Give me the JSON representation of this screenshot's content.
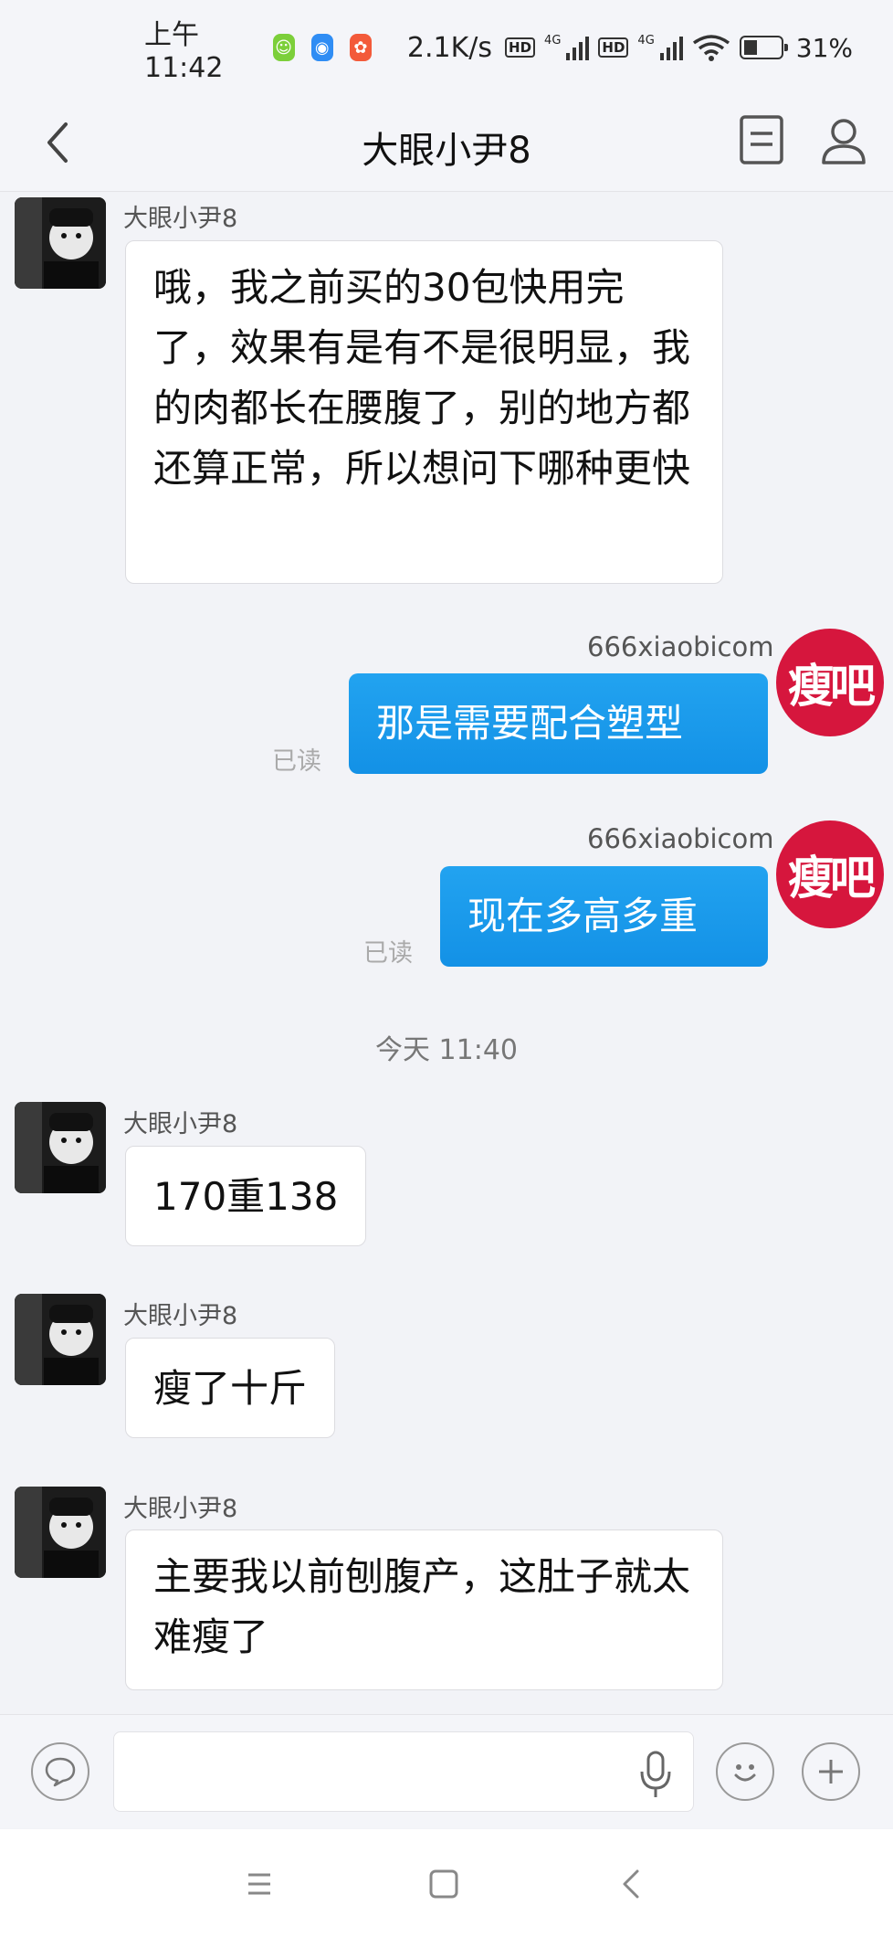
{
  "status_bar": {
    "time": "上午11:42",
    "net_speed": "2.1K/s",
    "hd_label": "HD",
    "net_type": "4G",
    "battery": "31%",
    "battery_level": 0.31
  },
  "header": {
    "title": "大眼小尹8"
  },
  "conversation": {
    "contact_name": "大眼小尹8",
    "self_name": "666xiaobicom",
    "self_avatar_text": "瘦吧",
    "read_label": "已读",
    "timestamp": "今天  11:40",
    "messages_before": [
      {
        "text": "哦，我之前买的30包快用完了，效果有是有不是很明显，我的肉都长在腰腹了，别的地方都还算正常，所以想问下哪种更快"
      }
    ],
    "outgoing": [
      {
        "text": "那是需要配合塑型"
      },
      {
        "text": "现在多高多重"
      }
    ],
    "messages_after": [
      {
        "text": "170重138"
      },
      {
        "text": "瘦了十斤"
      },
      {
        "text": "主要我以前刨腹产，这肚子就太难瘦了"
      }
    ]
  },
  "input_bar": {
    "placeholder": ""
  },
  "icons": {
    "back": "chevron-left-icon",
    "doc": "document-icon",
    "profile": "person-icon",
    "voice": "speech-bubble-icon",
    "mic": "microphone-icon",
    "emoji": "smiley-icon",
    "plus": "plus-icon",
    "menu": "menu-icon",
    "home": "home-square-icon",
    "sys_back": "back-chevron-icon"
  }
}
